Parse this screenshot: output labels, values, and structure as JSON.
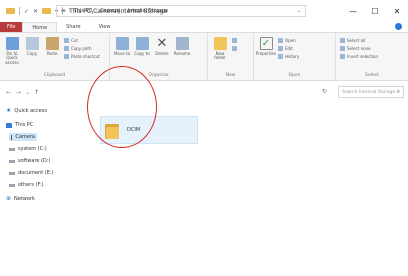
{
  "window": {
    "title": "This PC\\Camera\\Internal Storage",
    "controls": [
      "—",
      "☐",
      "✕"
    ]
  },
  "quick_access": {
    "check_glyph": "✓",
    "close_glyph": "✕",
    "pin_glyph": "▾"
  },
  "ribbon_tabs": [
    "File",
    "Home",
    "Share",
    "View"
  ],
  "ribbon": {
    "clipboard": {
      "label": "Clipboard",
      "pin": "Pin to Quick access",
      "copy": "Copy",
      "paste": "Paste",
      "cut": "Cut",
      "copy_path": "Copy path",
      "paste_shortcut": "Paste shortcut"
    },
    "organize": {
      "label": "Organize",
      "move_to": "Move to",
      "copy_to": "Copy to",
      "delete": "Delete",
      "rename": "Rename"
    },
    "new": {
      "label": "New",
      "new_folder": "New folder"
    },
    "open": {
      "label": "Open",
      "properties": "Properties",
      "open": "Open",
      "edit": "Edit",
      "history": "History"
    },
    "select": {
      "label": "Select",
      "select_all": "Select all",
      "select_none": "Select none",
      "invert": "Invert selection"
    }
  },
  "address": {
    "back": "←",
    "forward": "→",
    "up_dropdown": "⌄",
    "up": "↑",
    "breadcrumb": [
      "This PC",
      "Camera",
      "Internal Storage"
    ],
    "dropdown_glyph": "⌄",
    "refresh_glyph": "↻",
    "search_placeholder": "Search Internal Storage",
    "search_glyph": "⌕"
  },
  "nav_pane": {
    "quick_access": "Quick access",
    "this_pc": "This PC",
    "camera": "Camera",
    "drives": [
      "system (C:)",
      "software (D:)",
      "document (E:)",
      "others (F:)"
    ],
    "network": "Network"
  },
  "content": {
    "folders": [
      {
        "name": "DCIM"
      }
    ]
  },
  "colors": {
    "file_tab": "#b83b3b",
    "folder": "#f2c45a",
    "selection": "#e5f1fb",
    "annotation_circle": "#d62b2b"
  }
}
